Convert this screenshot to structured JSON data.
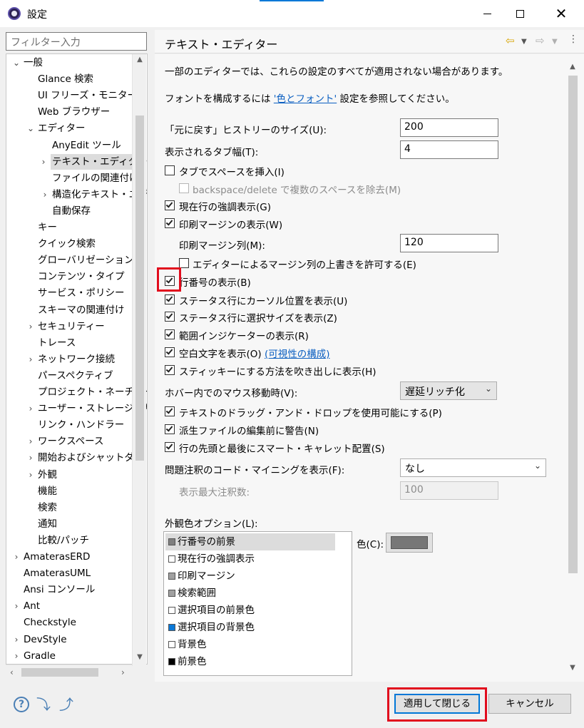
{
  "window": {
    "title": "設定",
    "minimize": "—",
    "close": "✕"
  },
  "filter": {
    "placeholder": "フィルター入力"
  },
  "tree": [
    {
      "label": "一般",
      "twisty": "⌄"
    },
    {
      "label": "Glance 検索",
      "twisty": ""
    },
    {
      "label": "UI フリーズ・モニター",
      "twisty": ""
    },
    {
      "label": "Web ブラウザー",
      "twisty": ""
    },
    {
      "label": "エディター",
      "twisty": "⌄"
    },
    {
      "label": "AnyEdit ツール",
      "twisty": ""
    },
    {
      "label": "テキスト・エディター",
      "twisty": "›",
      "selected": true
    },
    {
      "label": "ファイルの関連付け",
      "twisty": ""
    },
    {
      "label": "構造化テキスト・エデ",
      "twisty": "›"
    },
    {
      "label": "自動保存",
      "twisty": ""
    },
    {
      "label": "キー",
      "twisty": ""
    },
    {
      "label": "クイック検索",
      "twisty": ""
    },
    {
      "label": "グローバリゼーション",
      "twisty": ""
    },
    {
      "label": "コンテンツ・タイプ",
      "twisty": ""
    },
    {
      "label": "サービス・ポリシー",
      "twisty": ""
    },
    {
      "label": "スキーマの関連付け",
      "twisty": ""
    },
    {
      "label": "セキュリティー",
      "twisty": "›"
    },
    {
      "label": "トレース",
      "twisty": ""
    },
    {
      "label": "ネットワーク接続",
      "twisty": "›"
    },
    {
      "label": "パースペクティブ",
      "twisty": ""
    },
    {
      "label": "プロジェクト・ネーチャー",
      "twisty": ""
    },
    {
      "label": "ユーザー・ストレージ・サー",
      "twisty": "›"
    },
    {
      "label": "リンク・ハンドラー",
      "twisty": ""
    },
    {
      "label": "ワークスペース",
      "twisty": "›"
    },
    {
      "label": "開始およびシャットダウ",
      "twisty": "›"
    },
    {
      "label": "外観",
      "twisty": "›"
    },
    {
      "label": "機能",
      "twisty": ""
    },
    {
      "label": "検索",
      "twisty": ""
    },
    {
      "label": "通知",
      "twisty": ""
    },
    {
      "label": "比較/パッチ",
      "twisty": ""
    },
    {
      "label": "AmaterasERD",
      "twisty": "›"
    },
    {
      "label": "AmaterasUML",
      "twisty": ""
    },
    {
      "label": "Ansi コンソール",
      "twisty": ""
    },
    {
      "label": "Ant",
      "twisty": "›"
    },
    {
      "label": "Checkstyle",
      "twisty": ""
    },
    {
      "label": "DevStyle",
      "twisty": "›"
    },
    {
      "label": "Gradle",
      "twisty": "›"
    }
  ],
  "page": {
    "title": "テキスト・エディター",
    "intro": "一部のエディターでは、これらの設定のすべてが適用されない場合があります。",
    "font_pre": "フォントを構成するには ",
    "font_link": "'色とフォント'",
    "font_post": " 設定を参照してください。",
    "undo_label": "「元に戻す」ヒストリーのサイズ(U):",
    "undo_value": "200",
    "tab_label": "表示されるタブ幅(T):",
    "tab_value": "4",
    "insert_spaces": "タブでスペースを挿入(I)",
    "backspace": "backspace/delete で複数のスペースを除去(M)",
    "highlight_line": "現在行の強調表示(G)",
    "print_margin": "印刷マージンの表示(W)",
    "margin_col_label": "印刷マージン列(M):",
    "margin_col_value": "120",
    "allow_override": "エディターによるマージン列の上書きを許可する(E)",
    "line_numbers": "行番号の表示(B)",
    "status_cursor": "ステータス行にカーソル位置を表示(U)",
    "status_selection": "ステータス行に選択サイズを表示(Z)",
    "range_indicator": "範囲インジケーターの表示(R)",
    "whitespace": "空白文字を表示(O)",
    "whitespace_link": "(可視性の構成)",
    "sticky": "スティッキーにする方法を吹き出しに表示(H)",
    "hover_label": "ホバー内でのマウス移動時(V):",
    "hover_value": "遅延リッチ化",
    "drag_drop": "テキストのドラッグ・アンド・ドロップを使用可能にする(P)",
    "derived_warn": "派生ファイルの編集前に警告(N)",
    "smart_caret": "行の先頭と最後にスマート・キャレット配置(S)",
    "mining_label": "問題注釈のコード・マイニングを表示(F):",
    "mining_value": "なし",
    "max_annot_label": "表示最大注釈数:",
    "max_annot_value": "100",
    "appearance_label": "外観色オプション(L):",
    "color_label": "色(C):"
  },
  "color_items": [
    {
      "label": "行番号の前景",
      "swatch": "#808080",
      "selected": true
    },
    {
      "label": "現在行の強調表示",
      "swatch": "#ffffff"
    },
    {
      "label": "印刷マージン",
      "swatch": "#a0a0a0"
    },
    {
      "label": "検索範囲",
      "swatch": "#a0a0a0"
    },
    {
      "label": "選択項目の前景色",
      "swatch": "#ffffff"
    },
    {
      "label": "選択項目の背景色",
      "swatch": "#0a78d7"
    },
    {
      "label": "背景色",
      "swatch": "#ffffff"
    },
    {
      "label": "前景色",
      "swatch": "#000000"
    }
  ],
  "buttons": {
    "apply_close": "適用して閉じる",
    "cancel": "キャンセル"
  },
  "colors": {
    "highlight": "#e10c1d",
    "link": "#0b5fc1",
    "accent": "#0078d7"
  }
}
